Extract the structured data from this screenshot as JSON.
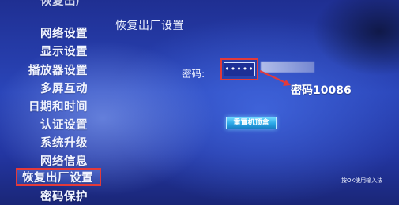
{
  "sidebar": {
    "partial_item": "恢复出厂",
    "items": [
      {
        "label": "网络设置"
      },
      {
        "label": "显示设置"
      },
      {
        "label": "播放器设置"
      },
      {
        "label": "多屏互动"
      },
      {
        "label": "日期和时间"
      },
      {
        "label": "认证设置"
      },
      {
        "label": "系统升级"
      },
      {
        "label": "网络信息"
      },
      {
        "label": "恢复出厂设置"
      },
      {
        "label": "密码保护"
      }
    ],
    "selected_index": 8
  },
  "main": {
    "title": "恢复出厂设置",
    "password_label": "密码:",
    "password_value": "•••••",
    "annotation": "密码10086",
    "reset_button": "重置机顶盒",
    "hint": "按OK使用输入法"
  },
  "colors": {
    "highlight_border": "#e33a3a",
    "button": "#2aa7e6",
    "background": "#2a45b9"
  }
}
